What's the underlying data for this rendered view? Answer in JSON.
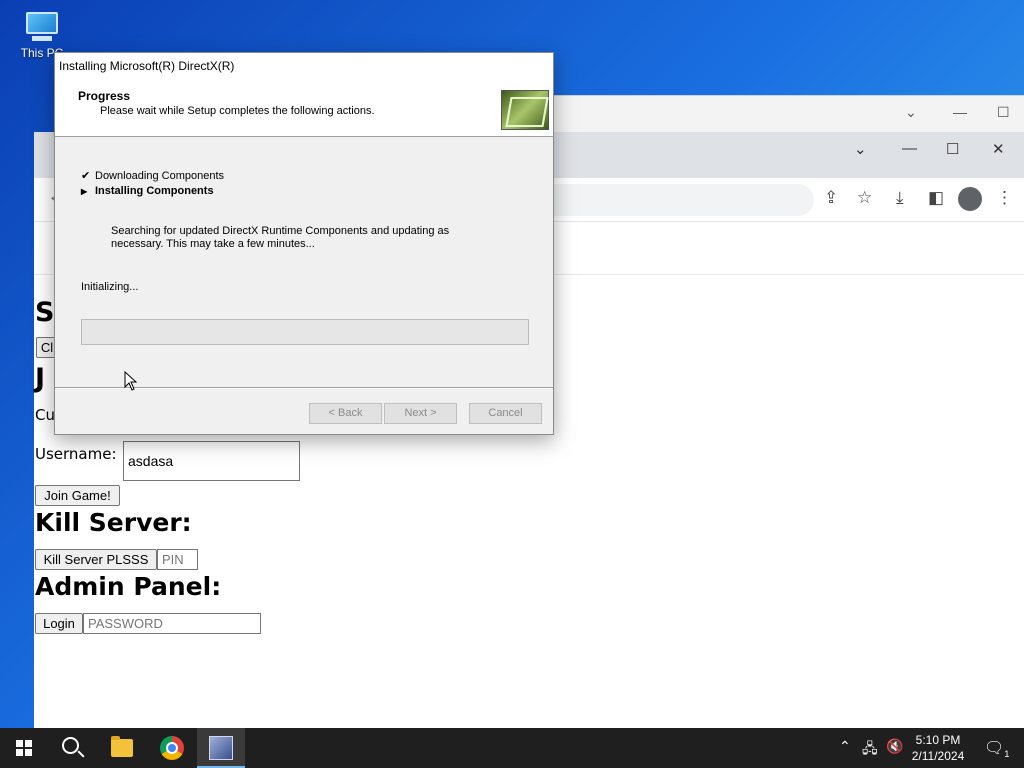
{
  "desktop": {
    "icon_label": "This PC"
  },
  "dialog": {
    "title": "Installing Microsoft(R) DirectX(R)",
    "header_title": "Progress",
    "header_subtitle": "Please wait while Setup completes the following actions.",
    "steps": [
      {
        "mark": "✔",
        "label": "Downloading Components",
        "bold": false
      },
      {
        "mark": "▶",
        "label": "Installing Components",
        "bold": true
      }
    ],
    "description": "Searching for updated DirectX Runtime Components and updating as necessary. This may take a few minutes...",
    "status": "Initializing...",
    "progress_percent": 0,
    "back_label": "< Back",
    "next_label": "Next >",
    "cancel_label": "Cancel"
  },
  "page": {
    "heading_s": "S",
    "button_c": "Cl",
    "heading_j": "J",
    "text_cu": "Cu",
    "username_label": "Username:",
    "username_value": "asdasa",
    "join_label": "Join Game!",
    "kill_heading": "Kill Server:",
    "kill_button": "Kill Server PLSSS",
    "pin_placeholder": "PIN",
    "admin_heading": "Admin Panel:",
    "login_button": "Login",
    "password_placeholder": "PASSWORD"
  },
  "taskbar": {
    "time": "5:10 PM",
    "date": "2/11/2024",
    "notifications": "1"
  }
}
